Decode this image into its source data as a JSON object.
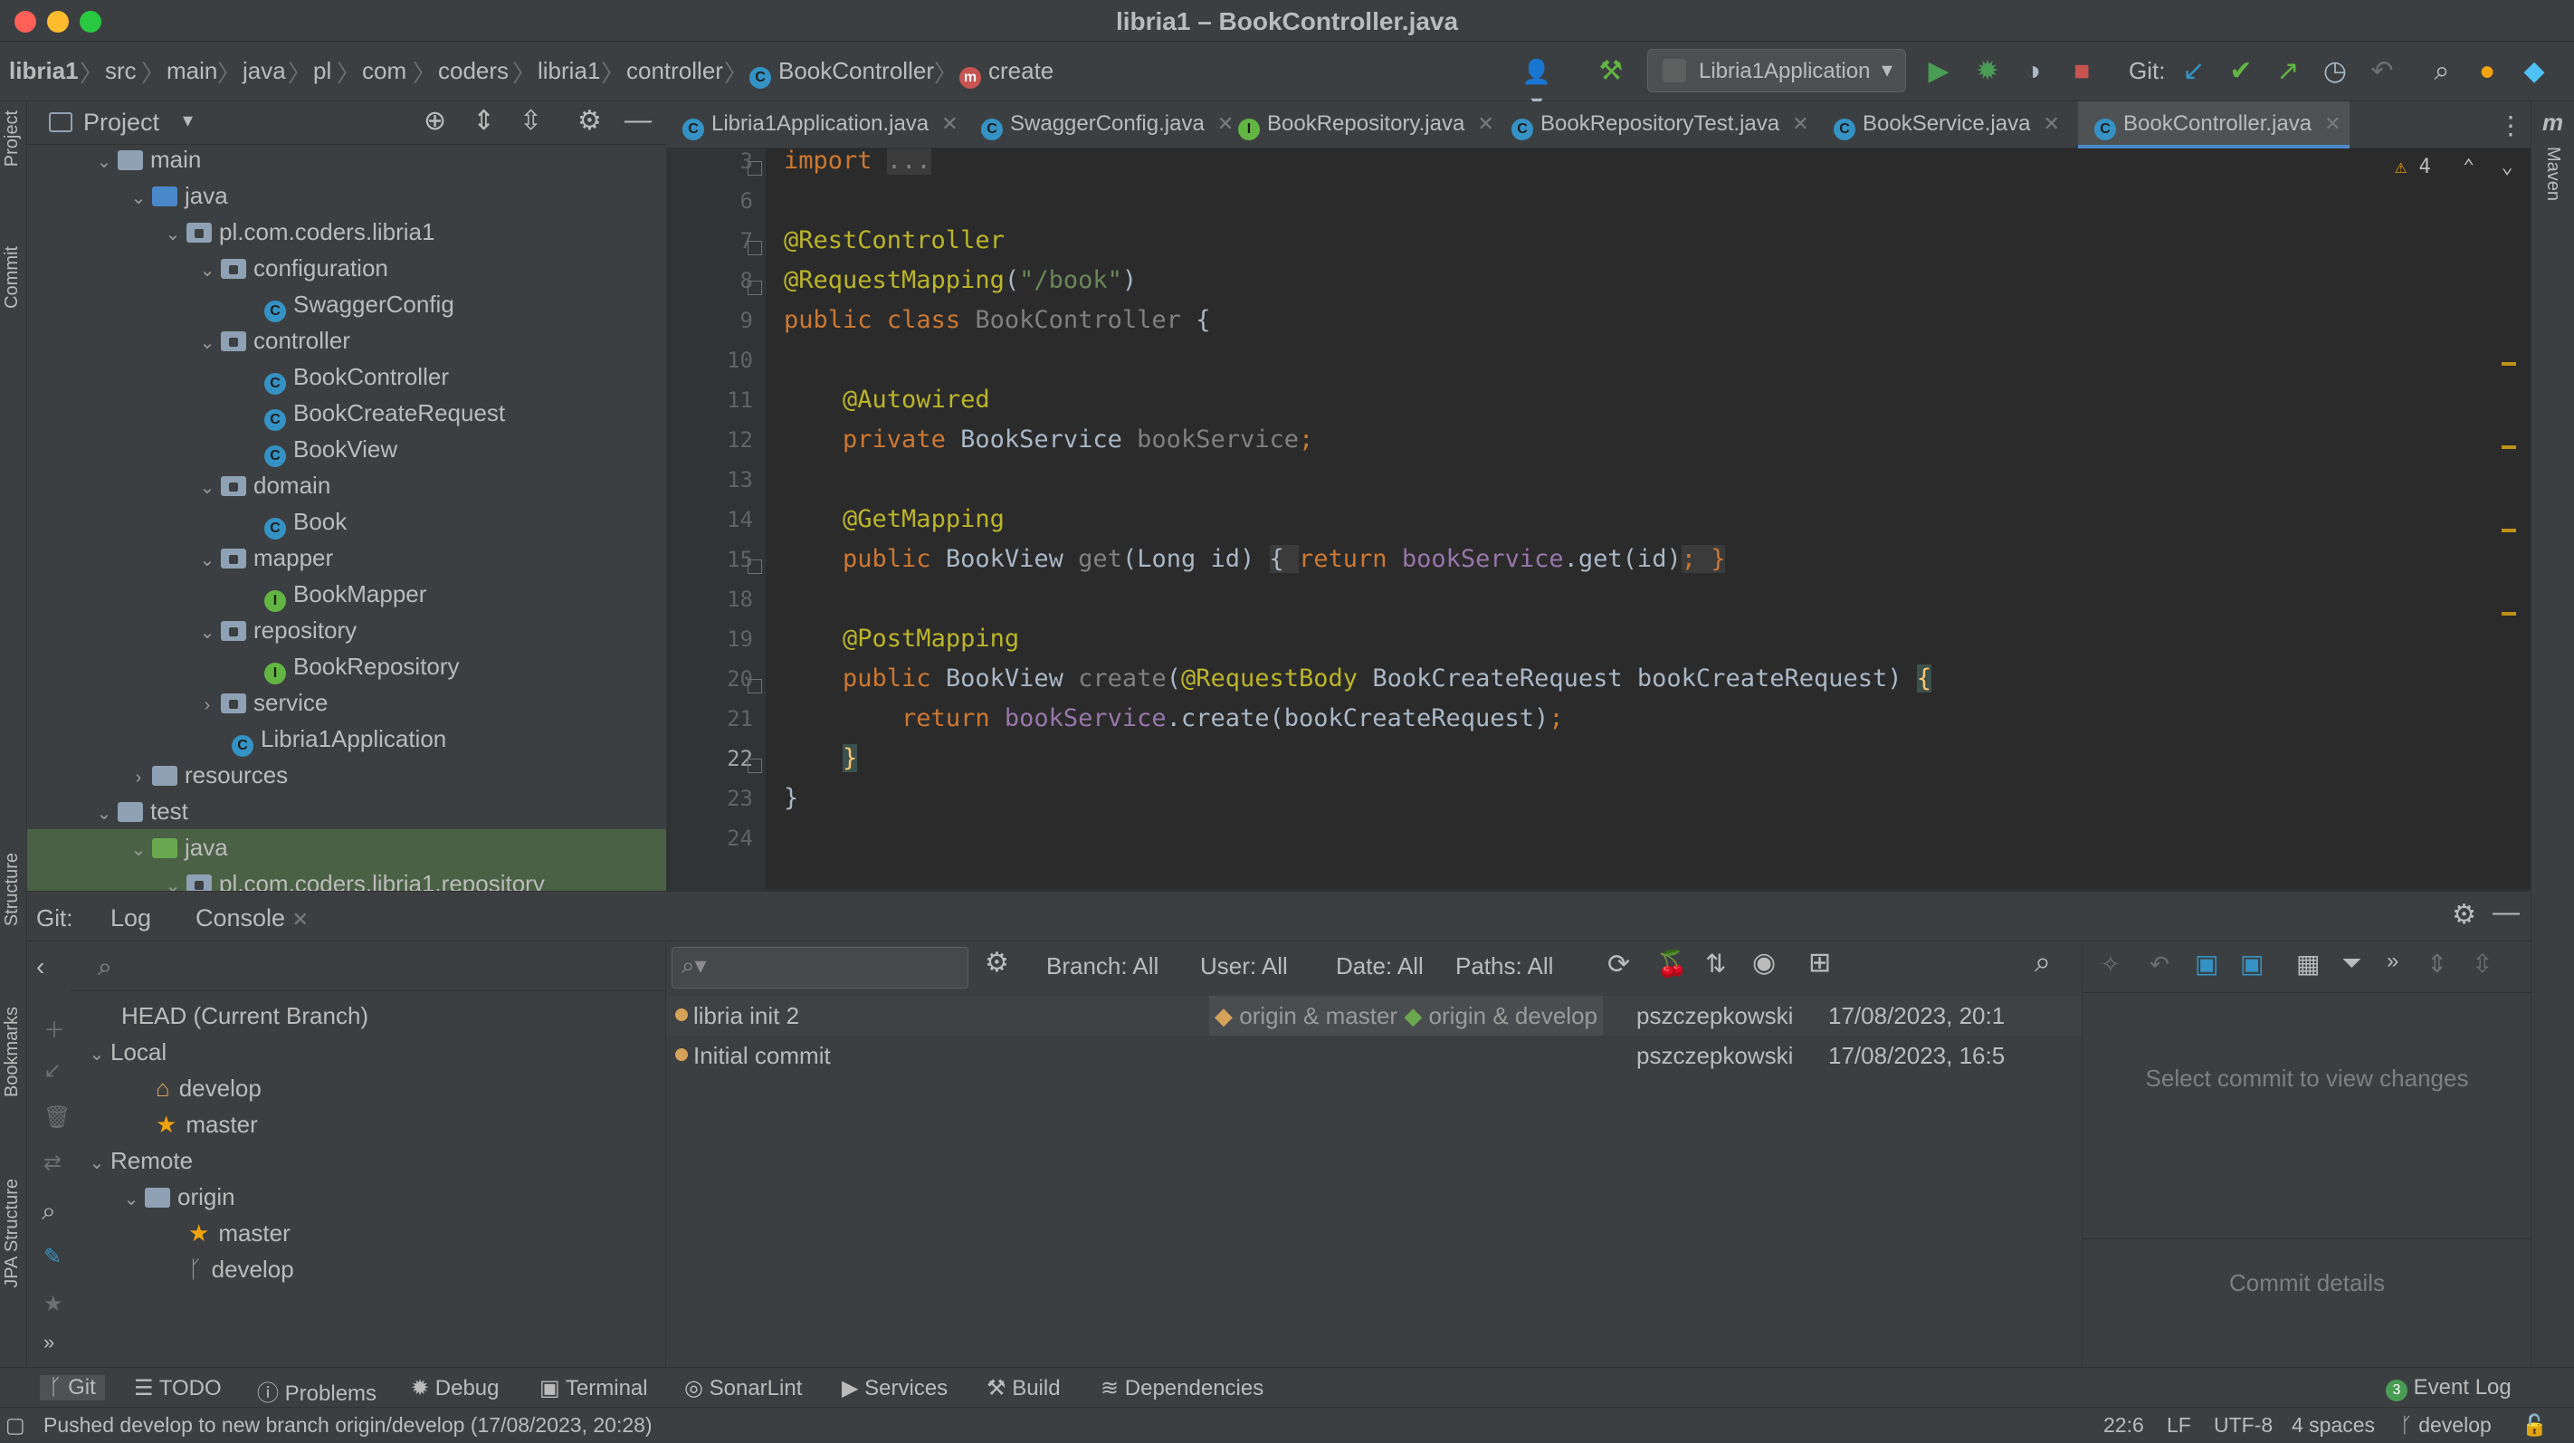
{
  "window": {
    "title": "libria1 – BookController.java"
  },
  "breadcrumbs": [
    "libria1",
    "src",
    "main",
    "java",
    "pl",
    "com",
    "coders",
    "libria1",
    "controller",
    "BookController",
    "create"
  ],
  "toolbar": {
    "run_config": "Libria1Application",
    "git_label": "Git:"
  },
  "left_strip": {
    "project": "Project",
    "commit": "Commit",
    "structure": "Structure",
    "bookmarks": "Bookmarks",
    "jpa_structure": "JPA Structure"
  },
  "right_strip": {
    "maven": "Maven",
    "maven_icon": "m"
  },
  "project": {
    "title": "Project",
    "tree": [
      {
        "label": "main",
        "type": "folder"
      },
      {
        "label": "java",
        "type": "src"
      },
      {
        "label": "pl.com.coders.libria1",
        "type": "pkg"
      },
      {
        "label": "configuration",
        "type": "pkg"
      },
      {
        "label": "SwaggerConfig",
        "type": "class"
      },
      {
        "label": "controller",
        "type": "pkg"
      },
      {
        "label": "BookController",
        "type": "class"
      },
      {
        "label": "BookCreateRequest",
        "type": "class"
      },
      {
        "label": "BookView",
        "type": "class"
      },
      {
        "label": "domain",
        "type": "pkg"
      },
      {
        "label": "Book",
        "type": "class"
      },
      {
        "label": "mapper",
        "type": "pkg"
      },
      {
        "label": "BookMapper",
        "type": "interface"
      },
      {
        "label": "repository",
        "type": "pkg"
      },
      {
        "label": "BookRepository",
        "type": "interface"
      },
      {
        "label": "service",
        "type": "pkg"
      },
      {
        "label": "Libria1Application",
        "type": "class"
      },
      {
        "label": "resources",
        "type": "res"
      },
      {
        "label": "test",
        "type": "folder"
      },
      {
        "label": "java",
        "type": "test"
      },
      {
        "label": "pl.com.coders.libria1.repository",
        "type": "pkg"
      }
    ]
  },
  "tabs": [
    {
      "label": "Libria1Application.java",
      "badge": "C"
    },
    {
      "label": "SwaggerConfig.java",
      "badge": "C"
    },
    {
      "label": "BookRepository.java",
      "badge": "I"
    },
    {
      "label": "BookRepositoryTest.java",
      "badge": "C"
    },
    {
      "label": "BookService.java",
      "badge": "C"
    },
    {
      "label": "BookController.java",
      "badge": "C"
    }
  ],
  "editor": {
    "warning_count": "4",
    "line_numbers": [
      "3",
      "6",
      "7",
      "8",
      "9",
      "10",
      "11",
      "12",
      "13",
      "14",
      "15",
      "18",
      "19",
      "20",
      "21",
      "22",
      "23",
      "24"
    ],
    "current_line": "22",
    "code": {
      "import_kw": "import",
      "import_fold": "...",
      "rest_controller": "@RestController",
      "request_mapping": "@RequestMapping",
      "path_open": "(",
      "path": "\"/book\"",
      "path_close": ")",
      "public": "public",
      "class": "class",
      "class_name": "BookController",
      "brace_open": "{",
      "autowired": "@Autowired",
      "private": "private",
      "service_type": "BookService",
      "service_field": "bookService",
      "semicolon": ";",
      "get_mapping": "@GetMapping",
      "view_type": "BookView",
      "get_name": "get",
      "get_params": "(Long id)",
      "get_body_open": "{ ",
      "return": "return",
      "get_call_field": "bookService",
      "get_call": ".get(id)",
      "get_body_close": "; }",
      "post_mapping": "@PostMapping",
      "create_name": "create",
      "request_body": "@RequestBody",
      "create_params": "BookCreateRequest bookCreateRequest)",
      "create_call_field": "bookService",
      "create_call": ".create(bookCreateRequest)",
      "brace_close": "}"
    }
  },
  "git": {
    "label": "Git:",
    "tab_log": "Log",
    "tab_console": "Console",
    "branches": {
      "head": "HEAD (Current Branch)",
      "local": "Local",
      "local_develop": "develop",
      "local_master": "master",
      "remote": "Remote",
      "origin": "origin",
      "remote_master": "master",
      "remote_develop": "develop"
    },
    "filters": {
      "branch": "Branch: All",
      "user": "User: All",
      "date": "Date: All",
      "paths": "Paths: All"
    },
    "commits": [
      {
        "message": "libria init 2",
        "tags": [
          "origin & master",
          "origin & develop"
        ],
        "author": "pszczepkowski",
        "date": "17/08/2023, 20:1"
      },
      {
        "message": "Initial commit",
        "tags": [],
        "author": "pszczepkowski",
        "date": "17/08/2023, 16:5"
      }
    ],
    "changes_placeholder": "Select commit to view changes",
    "details_placeholder": "Commit details"
  },
  "tool_tabs": {
    "git": "Git",
    "todo": "TODO",
    "problems": "Problems",
    "debug": "Debug",
    "terminal": "Terminal",
    "sonarlint": "SonarLint",
    "services": "Services",
    "build": "Build",
    "dependencies": "Dependencies",
    "event_log_count": "3",
    "event_log": "Event Log"
  },
  "status": {
    "message": "Pushed develop to new branch origin/develop (17/08/2023, 20:28)",
    "position": "22:6",
    "line_sep": "LF",
    "encoding": "UTF-8",
    "indent": "4 spaces",
    "branch": "develop"
  },
  "colors": {
    "accent": "#4a88c7",
    "keyword": "#cc7832",
    "annotation": "#bbb529",
    "string": "#6a8759",
    "field": "#9876aa"
  }
}
